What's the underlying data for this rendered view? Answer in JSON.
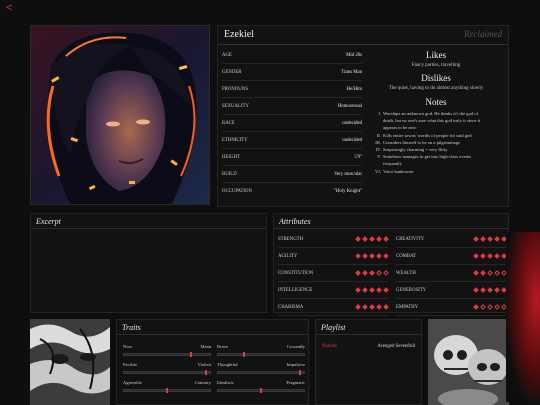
{
  "nav": {
    "back_glyph": "<"
  },
  "profile": {
    "name": "Ezekiel",
    "status": "Reclaimed",
    "info": [
      {
        "label": "AGE",
        "value": "Mid 20s"
      },
      {
        "label": "GENDER",
        "value": "Trans Man"
      },
      {
        "label": "PRONOUNS",
        "value": "He/Him"
      },
      {
        "label": "SEXUALITY",
        "value": "Homosexual"
      },
      {
        "label": "RACE",
        "value": "undecided"
      },
      {
        "label": "ETHNICITY",
        "value": "undecided"
      },
      {
        "label": "HEIGHT",
        "value": "5'9\""
      },
      {
        "label": "BUILD",
        "value": "Very muscular"
      },
      {
        "label": "OCCUPATION",
        "value": "\"Holy Knight\""
      }
    ],
    "likes_title": "Likes",
    "likes": "Fancy parties, travelling",
    "dislikes_title": "Dislikes",
    "dislikes": "The quiet, having to do almost anything slowly",
    "notes_title": "Notes",
    "notes": [
      {
        "num": "I.",
        "lines": [
          "Worships an unknown god. He thinks it's the god of",
          "death, but no one's sure what this god truly is since it",
          "appears to be new"
        ]
      },
      {
        "num": "II.",
        "lines": [
          "Kills entire towns' worths of people for said god"
        ]
      },
      {
        "num": "III.",
        "lines": [
          "Considers himself to be on a pilgrimmage"
        ]
      },
      {
        "num": "IV.",
        "lines": [
          "Surprisingly charming + very flirty"
        ]
      },
      {
        "num": "V.",
        "lines": [
          "Somehow manages to get into high-class events",
          "frequently"
        ]
      },
      {
        "num": "VI.",
        "lines": [
          "Voice bankowen"
        ]
      }
    ]
  },
  "excerpt": {
    "title": "Excerpt"
  },
  "attributes": {
    "title": "Attributes",
    "left": [
      {
        "label": "STRENGTH",
        "level": 5
      },
      {
        "label": "AGILITY",
        "level": 5
      },
      {
        "label": "CONSTITUTION",
        "level": 3
      },
      {
        "label": "INTELLIGENCE",
        "level": 5
      },
      {
        "label": "CHARISMA",
        "level": 5
      }
    ],
    "right": [
      {
        "label": "CREATIVITY",
        "level": 5
      },
      {
        "label": "COMBAT",
        "level": 5
      },
      {
        "label": "WEALTH",
        "level": 2
      },
      {
        "label": "GENEROSITY",
        "level": 5
      },
      {
        "label": "EMPATHY",
        "level": 1
      }
    ],
    "max": 5,
    "accent": "#e03a44"
  },
  "traits": {
    "title": "Traits",
    "items": [
      {
        "left": "Nice",
        "right": "Mean",
        "value": 0.78
      },
      {
        "left": "Brave",
        "right": "Cowardly",
        "value": 0.3
      },
      {
        "left": "Pacifist",
        "right": "Violent",
        "value": 0.97
      },
      {
        "left": "Thoughtful",
        "right": "Impulsive",
        "value": 0.97
      },
      {
        "left": "Agreeable",
        "right": "Contrary",
        "value": 0.5
      },
      {
        "left": "Idealistic",
        "right": "Pragmatic",
        "value": 0.5
      }
    ]
  },
  "playlist": {
    "title": "Playlist",
    "songs": [
      {
        "title": "Nobody",
        "artist": "Avenged Sevenfold"
      }
    ]
  },
  "colors": {
    "accent": "#e03a44",
    "background": "#0e0e0e",
    "panel": "#121212"
  }
}
